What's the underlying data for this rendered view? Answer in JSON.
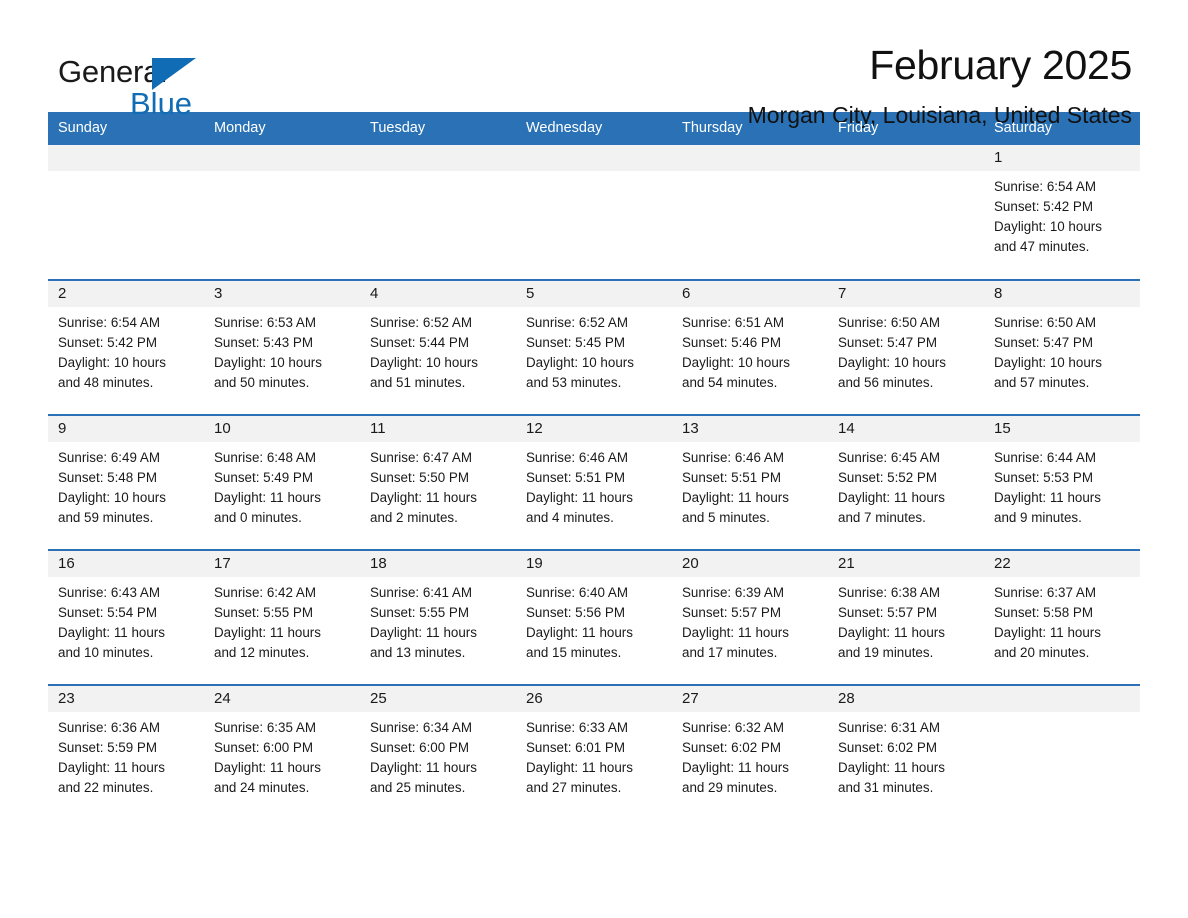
{
  "brand": {
    "name_part1": "General",
    "name_part2": "Blue",
    "triangle_color": "#106cb5"
  },
  "header": {
    "title": "February 2025",
    "subtitle": "Morgan City, Louisiana, United States"
  },
  "theme": {
    "header_blue": "#2a72b5",
    "daynum_bg": "#f2f2f2",
    "text": "#1a1a1a"
  },
  "calendar": {
    "weekday_headers": [
      "Sunday",
      "Monday",
      "Tuesday",
      "Wednesday",
      "Thursday",
      "Friday",
      "Saturday"
    ],
    "weeks": [
      [
        {
          "day": "",
          "blank": true
        },
        {
          "day": "",
          "blank": true
        },
        {
          "day": "",
          "blank": true
        },
        {
          "day": "",
          "blank": true
        },
        {
          "day": "",
          "blank": true
        },
        {
          "day": "",
          "blank": true
        },
        {
          "day": "1",
          "sunrise": "Sunrise: 6:54 AM",
          "sunset": "Sunset: 5:42 PM",
          "daylight_line1": "Daylight: 10 hours",
          "daylight_line2": "and 47 minutes."
        }
      ],
      [
        {
          "day": "2",
          "sunrise": "Sunrise: 6:54 AM",
          "sunset": "Sunset: 5:42 PM",
          "daylight_line1": "Daylight: 10 hours",
          "daylight_line2": "and 48 minutes."
        },
        {
          "day": "3",
          "sunrise": "Sunrise: 6:53 AM",
          "sunset": "Sunset: 5:43 PM",
          "daylight_line1": "Daylight: 10 hours",
          "daylight_line2": "and 50 minutes."
        },
        {
          "day": "4",
          "sunrise": "Sunrise: 6:52 AM",
          "sunset": "Sunset: 5:44 PM",
          "daylight_line1": "Daylight: 10 hours",
          "daylight_line2": "and 51 minutes."
        },
        {
          "day": "5",
          "sunrise": "Sunrise: 6:52 AM",
          "sunset": "Sunset: 5:45 PM",
          "daylight_line1": "Daylight: 10 hours",
          "daylight_line2": "and 53 minutes."
        },
        {
          "day": "6",
          "sunrise": "Sunrise: 6:51 AM",
          "sunset": "Sunset: 5:46 PM",
          "daylight_line1": "Daylight: 10 hours",
          "daylight_line2": "and 54 minutes."
        },
        {
          "day": "7",
          "sunrise": "Sunrise: 6:50 AM",
          "sunset": "Sunset: 5:47 PM",
          "daylight_line1": "Daylight: 10 hours",
          "daylight_line2": "and 56 minutes."
        },
        {
          "day": "8",
          "sunrise": "Sunrise: 6:50 AM",
          "sunset": "Sunset: 5:47 PM",
          "daylight_line1": "Daylight: 10 hours",
          "daylight_line2": "and 57 minutes."
        }
      ],
      [
        {
          "day": "9",
          "sunrise": "Sunrise: 6:49 AM",
          "sunset": "Sunset: 5:48 PM",
          "daylight_line1": "Daylight: 10 hours",
          "daylight_line2": "and 59 minutes."
        },
        {
          "day": "10",
          "sunrise": "Sunrise: 6:48 AM",
          "sunset": "Sunset: 5:49 PM",
          "daylight_line1": "Daylight: 11 hours",
          "daylight_line2": "and 0 minutes."
        },
        {
          "day": "11",
          "sunrise": "Sunrise: 6:47 AM",
          "sunset": "Sunset: 5:50 PM",
          "daylight_line1": "Daylight: 11 hours",
          "daylight_line2": "and 2 minutes."
        },
        {
          "day": "12",
          "sunrise": "Sunrise: 6:46 AM",
          "sunset": "Sunset: 5:51 PM",
          "daylight_line1": "Daylight: 11 hours",
          "daylight_line2": "and 4 minutes."
        },
        {
          "day": "13",
          "sunrise": "Sunrise: 6:46 AM",
          "sunset": "Sunset: 5:51 PM",
          "daylight_line1": "Daylight: 11 hours",
          "daylight_line2": "and 5 minutes."
        },
        {
          "day": "14",
          "sunrise": "Sunrise: 6:45 AM",
          "sunset": "Sunset: 5:52 PM",
          "daylight_line1": "Daylight: 11 hours",
          "daylight_line2": "and 7 minutes."
        },
        {
          "day": "15",
          "sunrise": "Sunrise: 6:44 AM",
          "sunset": "Sunset: 5:53 PM",
          "daylight_line1": "Daylight: 11 hours",
          "daylight_line2": "and 9 minutes."
        }
      ],
      [
        {
          "day": "16",
          "sunrise": "Sunrise: 6:43 AM",
          "sunset": "Sunset: 5:54 PM",
          "daylight_line1": "Daylight: 11 hours",
          "daylight_line2": "and 10 minutes."
        },
        {
          "day": "17",
          "sunrise": "Sunrise: 6:42 AM",
          "sunset": "Sunset: 5:55 PM",
          "daylight_line1": "Daylight: 11 hours",
          "daylight_line2": "and 12 minutes."
        },
        {
          "day": "18",
          "sunrise": "Sunrise: 6:41 AM",
          "sunset": "Sunset: 5:55 PM",
          "daylight_line1": "Daylight: 11 hours",
          "daylight_line2": "and 13 minutes."
        },
        {
          "day": "19",
          "sunrise": "Sunrise: 6:40 AM",
          "sunset": "Sunset: 5:56 PM",
          "daylight_line1": "Daylight: 11 hours",
          "daylight_line2": "and 15 minutes."
        },
        {
          "day": "20",
          "sunrise": "Sunrise: 6:39 AM",
          "sunset": "Sunset: 5:57 PM",
          "daylight_line1": "Daylight: 11 hours",
          "daylight_line2": "and 17 minutes."
        },
        {
          "day": "21",
          "sunrise": "Sunrise: 6:38 AM",
          "sunset": "Sunset: 5:57 PM",
          "daylight_line1": "Daylight: 11 hours",
          "daylight_line2": "and 19 minutes."
        },
        {
          "day": "22",
          "sunrise": "Sunrise: 6:37 AM",
          "sunset": "Sunset: 5:58 PM",
          "daylight_line1": "Daylight: 11 hours",
          "daylight_line2": "and 20 minutes."
        }
      ],
      [
        {
          "day": "23",
          "sunrise": "Sunrise: 6:36 AM",
          "sunset": "Sunset: 5:59 PM",
          "daylight_line1": "Daylight: 11 hours",
          "daylight_line2": "and 22 minutes."
        },
        {
          "day": "24",
          "sunrise": "Sunrise: 6:35 AM",
          "sunset": "Sunset: 6:00 PM",
          "daylight_line1": "Daylight: 11 hours",
          "daylight_line2": "and 24 minutes."
        },
        {
          "day": "25",
          "sunrise": "Sunrise: 6:34 AM",
          "sunset": "Sunset: 6:00 PM",
          "daylight_line1": "Daylight: 11 hours",
          "daylight_line2": "and 25 minutes."
        },
        {
          "day": "26",
          "sunrise": "Sunrise: 6:33 AM",
          "sunset": "Sunset: 6:01 PM",
          "daylight_line1": "Daylight: 11 hours",
          "daylight_line2": "and 27 minutes."
        },
        {
          "day": "27",
          "sunrise": "Sunrise: 6:32 AM",
          "sunset": "Sunset: 6:02 PM",
          "daylight_line1": "Daylight: 11 hours",
          "daylight_line2": "and 29 minutes."
        },
        {
          "day": "28",
          "sunrise": "Sunrise: 6:31 AM",
          "sunset": "Sunset: 6:02 PM",
          "daylight_line1": "Daylight: 11 hours",
          "daylight_line2": "and 31 minutes."
        },
        {
          "day": "",
          "blank": true
        }
      ]
    ]
  }
}
